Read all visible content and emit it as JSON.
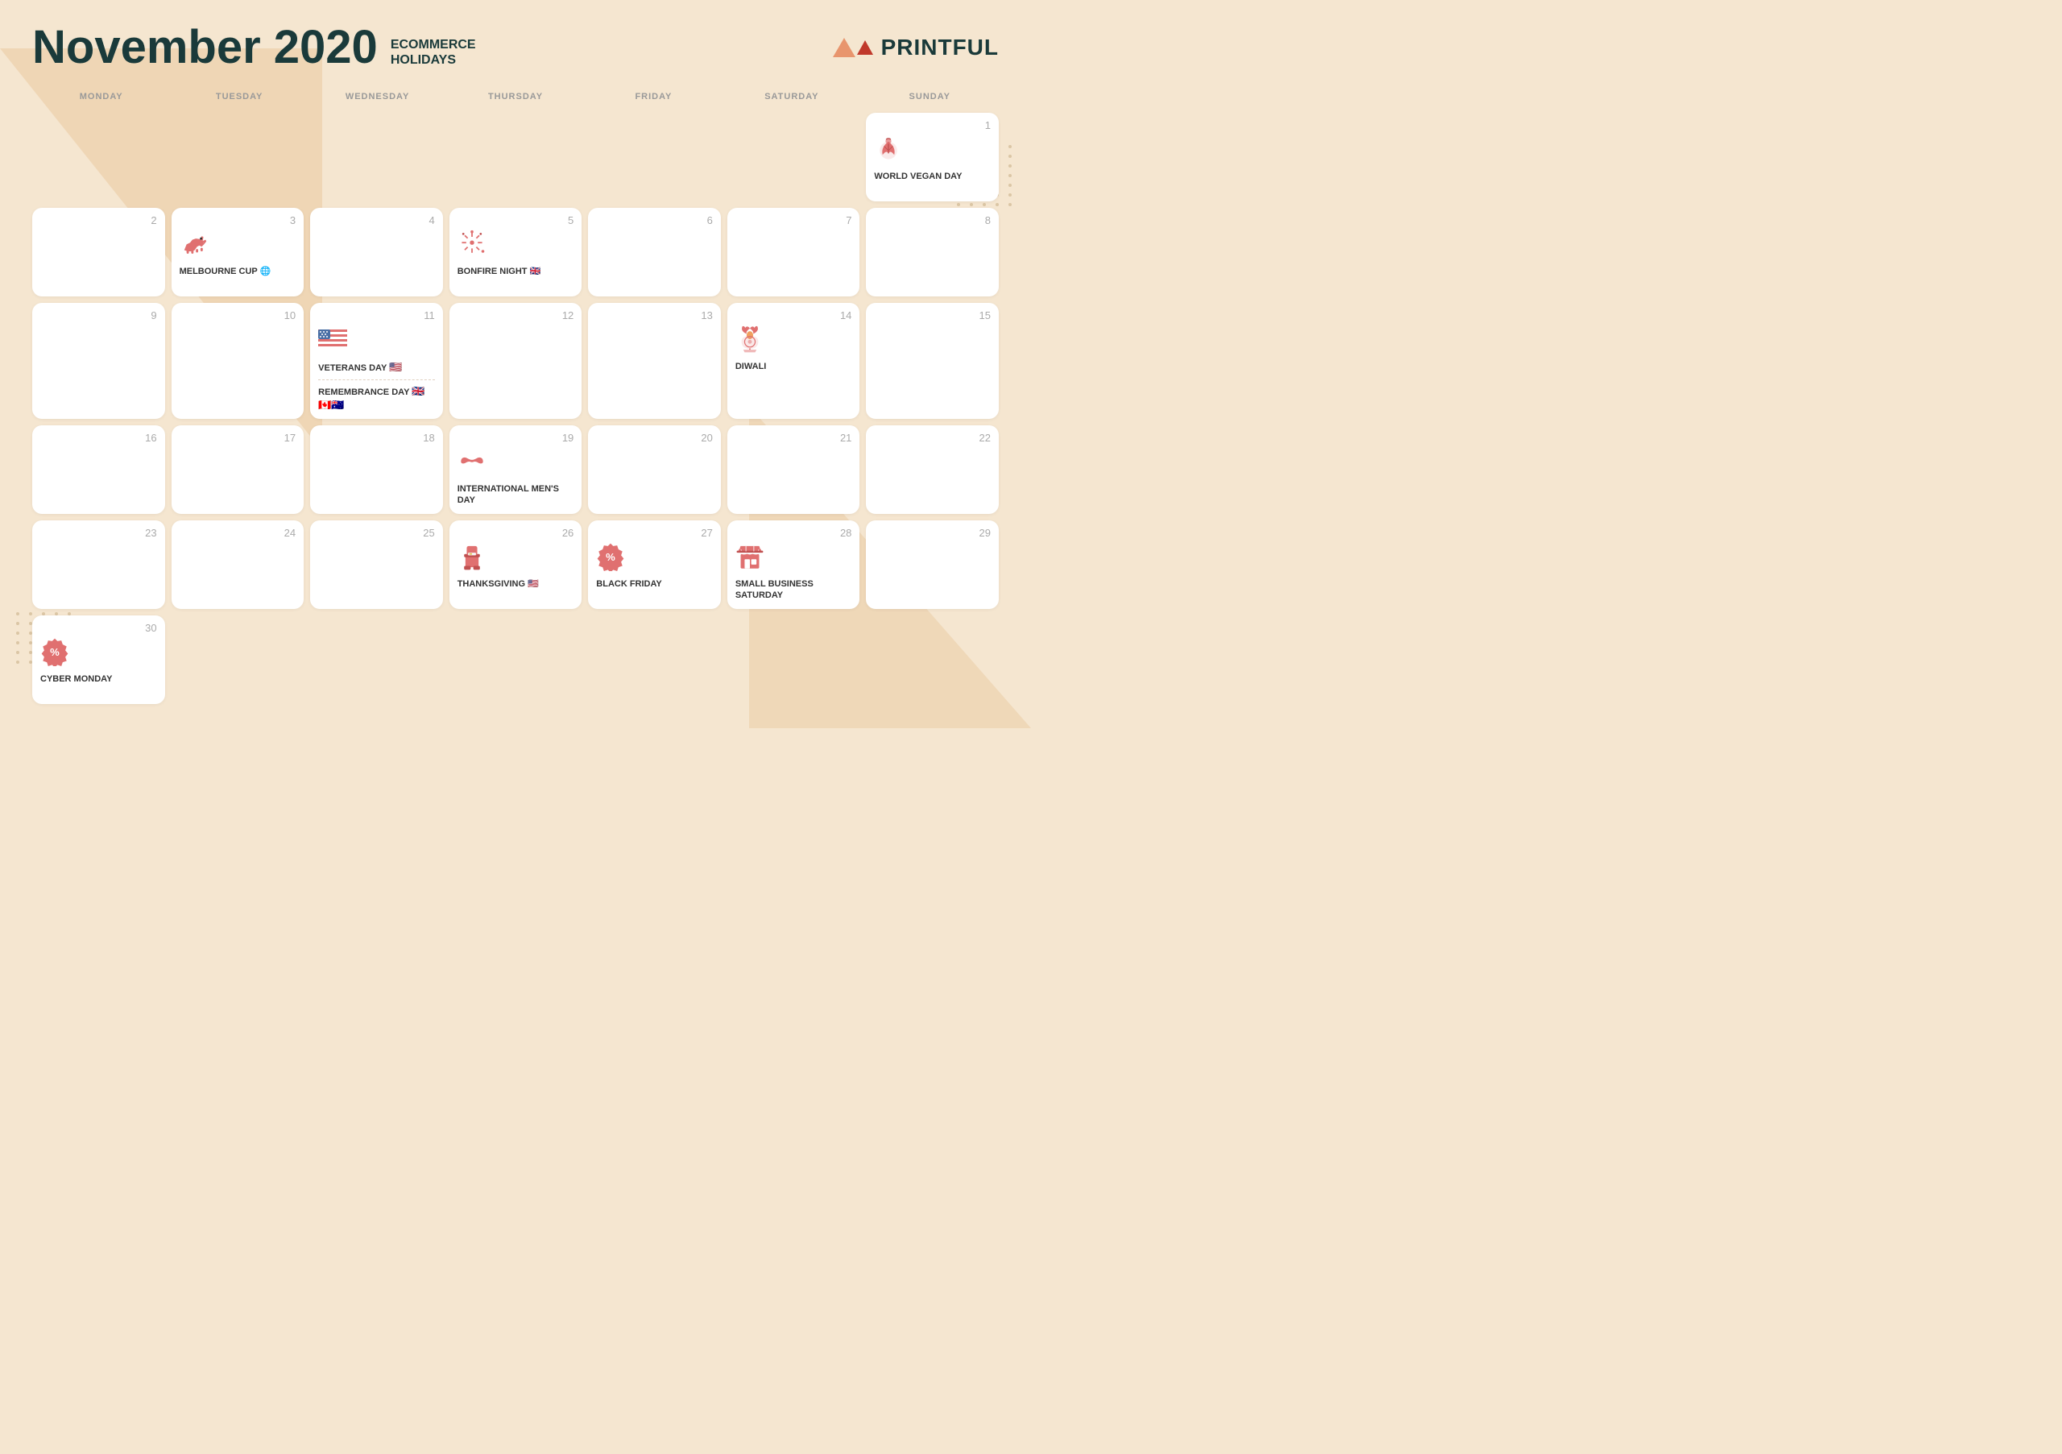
{
  "header": {
    "title": "November 2020",
    "subtitle_line1": "ECOMMERCE",
    "subtitle_line2": "HOLIDAYS",
    "logo_text": "PRINTFUL"
  },
  "days_of_week": [
    "MONDAY",
    "TUESDAY",
    "WEDNESDAY",
    "THURSDAY",
    "FRIDAY",
    "SATURDAY",
    "SUNDAY"
  ],
  "calendar": {
    "cells": [
      {
        "day": null,
        "empty": true
      },
      {
        "day": null,
        "empty": true
      },
      {
        "day": null,
        "empty": true
      },
      {
        "day": null,
        "empty": true
      },
      {
        "day": null,
        "empty": true
      },
      {
        "day": null,
        "empty": true
      },
      {
        "day": 1,
        "event": "WORLD VEGAN DAY",
        "icon": "vegan"
      },
      {
        "day": 2,
        "event": null
      },
      {
        "day": 3,
        "event": "MELBOURNE CUP 🌐",
        "icon": "horse"
      },
      {
        "day": 4,
        "event": null
      },
      {
        "day": 5,
        "event": "BONFIRE NIGHT 🇬🇧",
        "icon": "fireworks"
      },
      {
        "day": 6,
        "event": null
      },
      {
        "day": 7,
        "event": null
      },
      {
        "day": 8,
        "event": null
      },
      {
        "day": 9,
        "event": null
      },
      {
        "day": 10,
        "event": null
      },
      {
        "day": 11,
        "event_multi": true,
        "event1": "VETERANS DAY 🇺🇸",
        "icon1": "flag",
        "event2": "REMEMBRANCE DAY 🇬🇧🇨🇦🇦🇺",
        "icon2": null
      },
      {
        "day": 12,
        "event": null
      },
      {
        "day": 13,
        "event": null
      },
      {
        "day": 14,
        "event": "DIWALI",
        "icon": "diwali"
      },
      {
        "day": 15,
        "event": null
      },
      {
        "day": 16,
        "event": null
      },
      {
        "day": 17,
        "event": null
      },
      {
        "day": 18,
        "event": null
      },
      {
        "day": 19,
        "event": "INTERNATIONAL MEN'S DAY",
        "icon": "mustache"
      },
      {
        "day": 20,
        "event": null
      },
      {
        "day": 21,
        "event": null
      },
      {
        "day": 22,
        "event": null
      },
      {
        "day": 23,
        "event": null
      },
      {
        "day": 24,
        "event": null
      },
      {
        "day": 25,
        "event": null
      },
      {
        "day": 26,
        "event": "THANKSGIVING 🇺🇸",
        "icon": "pilgrim"
      },
      {
        "day": 27,
        "event": "BLACK FRIDAY",
        "icon": "discount"
      },
      {
        "day": 28,
        "event": "SMALL BUSINESS SATURDAY",
        "icon": "shop"
      },
      {
        "day": 29,
        "event": null
      },
      {
        "day": 30,
        "event": "CYBER MONDAY",
        "icon": "discount"
      }
    ]
  }
}
